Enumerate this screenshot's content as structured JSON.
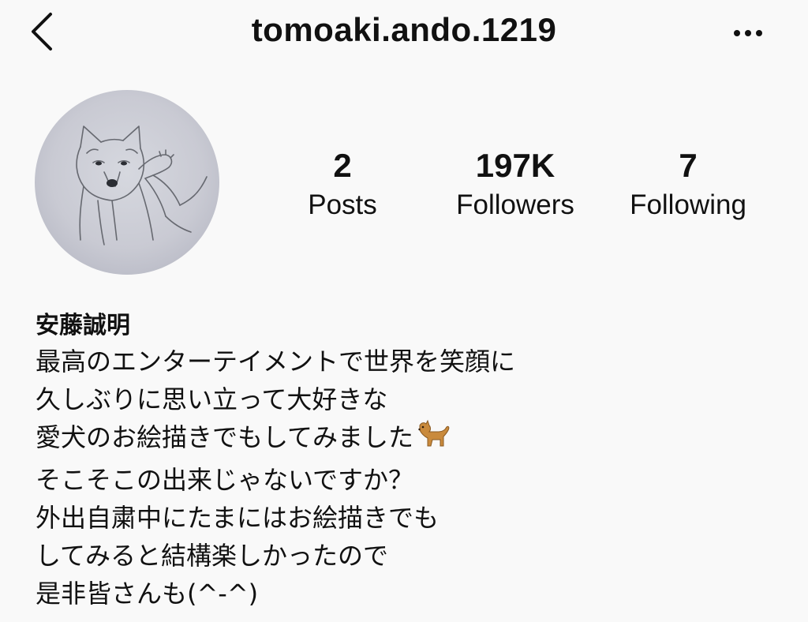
{
  "header": {
    "username": "tomoaki.ando.1219"
  },
  "stats": {
    "posts_count": "2",
    "posts_label": "Posts",
    "followers_count": "197K",
    "followers_label": "Followers",
    "following_count": "7",
    "following_label": "Following"
  },
  "bio": {
    "name": "安藤誠明",
    "lines": [
      "最高のエンターテイメントで世界を笑顔に",
      "久しぶりに思い立って大好きな",
      "愛犬のお絵描きでもしてみました",
      "そこそこの出来じゃないですか？",
      "外出自粛中にたまにはお絵描きでも",
      "してみると結構楽しかったので",
      "是非皆さんも(^-^)"
    ]
  },
  "icons": {
    "back": "chevron-left-icon",
    "more": "more-horizontal-icon",
    "emoji": "dog-emoji-icon"
  },
  "colors": {
    "background": "#f9f9f9",
    "text": "#111111",
    "avatar_bg": "#c9cad3"
  }
}
